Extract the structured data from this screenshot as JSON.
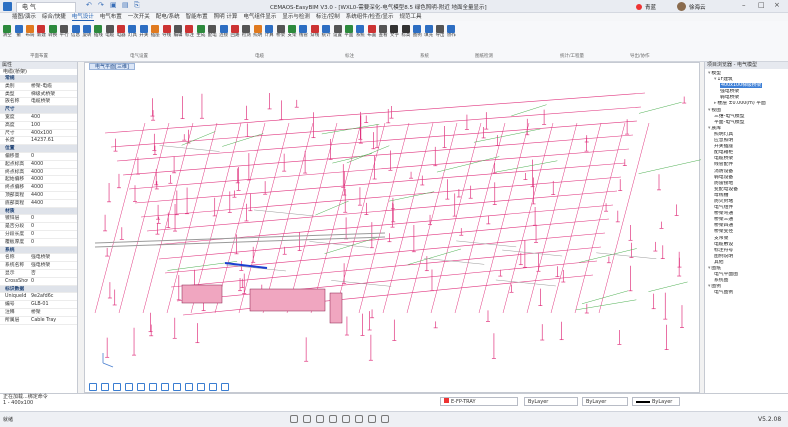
{
  "app": {
    "tab": "电 气",
    "title": "CEMAOS-EasyBIM V3.0 - [WXL0-需要深化-电气模型8.5 绿色照明-附近 地面全量显示]",
    "user_name": "徐海云",
    "badge": "青蓝"
  },
  "menu": [
    "插图/演示",
    "综合/快捷",
    "电气设计",
    "电气布置",
    "一次开关",
    "配电/系统",
    "智能布置",
    "照明 计算",
    "电气组件显示",
    "显示与检测",
    "标注/控制",
    "系统组件/检查/显示",
    "规范工具"
  ],
  "menu_active": 2,
  "ribbon": {
    "buttons": [
      {
        "label": "清空",
        "color": "#2d8a3d"
      },
      {
        "label": "撤",
        "color": "#2d6ec2"
      },
      {
        "label": "布局",
        "color": "#e07a1f"
      },
      {
        "label": "新建",
        "color": "#c33"
      },
      {
        "label": "转换",
        "color": "#2d8a3d"
      },
      {
        "label": "平行",
        "color": "#555"
      },
      {
        "label": "信息",
        "color": "#2d6ec2"
      },
      {
        "label": "旋转",
        "color": "#2d6ec2"
      },
      {
        "label": "插线",
        "color": "#2d8a3d"
      },
      {
        "label": "电缆",
        "color": "#555"
      },
      {
        "label": "电器",
        "color": "#c33"
      },
      {
        "label": "灯具",
        "color": "#2d6ec2"
      },
      {
        "label": "开关",
        "color": "#2d6ec2"
      },
      {
        "label": "插座",
        "color": "#e07a1f"
      },
      {
        "label": "导线",
        "color": "#c33"
      },
      {
        "label": "编辑",
        "color": "#555"
      },
      {
        "label": "标注",
        "color": "#c33"
      },
      {
        "label": "生成",
        "color": "#2d8a3d"
      },
      {
        "label": "配电",
        "color": "#555"
      },
      {
        "label": "连接",
        "color": "#2d6ec2"
      },
      {
        "label": "回路",
        "color": "#c33"
      },
      {
        "label": "检测",
        "color": "#555"
      },
      {
        "label": "照明",
        "color": "#e07a1f"
      },
      {
        "label": "计算",
        "color": "#2d6ec2"
      },
      {
        "label": "桥架",
        "color": "#555"
      },
      {
        "label": "支架",
        "color": "#2d8a3d"
      },
      {
        "label": "线管",
        "color": "#2d6ec2"
      },
      {
        "label": "穿线",
        "color": "#c33"
      },
      {
        "label": "统计",
        "color": "#2d6ec2"
      },
      {
        "label": "设置",
        "color": "#555"
      },
      {
        "label": "平面",
        "color": "#2d8a3d"
      },
      {
        "label": "系统",
        "color": "#2d6ec2"
      },
      {
        "label": "布置",
        "color": "#c33"
      },
      {
        "label": "查看",
        "color": "#555"
      },
      {
        "label": "文字",
        "color": "#333"
      },
      {
        "label": "标高",
        "color": "#333"
      },
      {
        "label": "图例",
        "color": "#2d6ec2"
      },
      {
        "label": "填充",
        "color": "#2d6ec2"
      },
      {
        "label": "导出",
        "color": "#555"
      },
      {
        "label": "协作",
        "color": "#2d6ec2"
      }
    ],
    "groups": [
      "平面布置",
      "电气设置",
      "电缆",
      "标注",
      "系统",
      "图纸检测",
      "统计/工程量",
      "导出/协作"
    ]
  },
  "left": {
    "head": "属性",
    "selection": "电缆(桥架)",
    "props": [
      {
        "k": "常规",
        "v": "",
        "sec": true
      },
      {
        "k": "类别",
        "v": "桥架-电缆"
      },
      {
        "k": "类型",
        "v": "梯级式桥架"
      },
      {
        "k": "族名称",
        "v": "电缆桥架"
      },
      {
        "k": "尺寸",
        "v": "",
        "sec": true
      },
      {
        "k": "宽度",
        "v": "400"
      },
      {
        "k": "高度",
        "v": "100"
      },
      {
        "k": "尺寸",
        "v": "400x100"
      },
      {
        "k": "长度",
        "v": "14237.61"
      },
      {
        "k": "位置",
        "v": "",
        "sec": true
      },
      {
        "k": "偏移量",
        "v": "0"
      },
      {
        "k": "起点标高",
        "v": "4000"
      },
      {
        "k": "终点标高",
        "v": "4000"
      },
      {
        "k": "起始偏移",
        "v": "4000"
      },
      {
        "k": "终点偏移",
        "v": "4000"
      },
      {
        "k": "顶部高程",
        "v": "4400"
      },
      {
        "k": "底部高程",
        "v": "4400"
      },
      {
        "k": "材质",
        "v": "",
        "sec": true
      },
      {
        "k": "镀锌层",
        "v": "0"
      },
      {
        "k": "是否分段",
        "v": "0"
      },
      {
        "k": "分段长度",
        "v": "0"
      },
      {
        "k": "覆板厚度",
        "v": "0"
      },
      {
        "k": "系统",
        "v": "",
        "sec": true
      },
      {
        "k": "名称",
        "v": "强电桥架"
      },
      {
        "k": "系统名称",
        "v": "强电桥架"
      },
      {
        "k": "显示",
        "v": "否"
      },
      {
        "k": "CrossShow",
        "v": "0"
      },
      {
        "k": "标识数据",
        "v": "",
        "sec": true
      },
      {
        "k": "UniqueId",
        "v": "9e2afd6c"
      },
      {
        "k": "编号",
        "v": "GLB-01"
      },
      {
        "k": "注释",
        "v": "桥架"
      },
      {
        "k": "所属层",
        "v": "Cable Tray"
      }
    ]
  },
  "viewport": {
    "tab": "电气平面[三维]"
  },
  "tree": {
    "head": "项目浏览器 - 电气模型",
    "items": [
      {
        "d": 0,
        "t": "模型",
        "tw": "▾"
      },
      {
        "d": 1,
        "t": "1F建筑",
        "tw": "▾"
      },
      {
        "d": 2,
        "t": "400x100梯级桥架",
        "sel": true
      },
      {
        "d": 2,
        "t": "强电桥架"
      },
      {
        "d": 2,
        "t": "弱电桥架"
      },
      {
        "d": 1,
        "t": "楼层 ±0.000(m) 平面",
        "tw": "▸"
      },
      {
        "d": 0,
        "t": "视图",
        "tw": "▾"
      },
      {
        "d": 1,
        "t": "三维-电气模型"
      },
      {
        "d": 1,
        "t": "平面-电气模型"
      },
      {
        "d": 0,
        "t": "族库",
        "tw": "▾"
      },
      {
        "d": 1,
        "t": "照明灯具"
      },
      {
        "d": 1,
        "t": "应急照明"
      },
      {
        "d": 1,
        "t": "开关插座"
      },
      {
        "d": 1,
        "t": "配电箱柜"
      },
      {
        "d": 1,
        "t": "电缆桥架"
      },
      {
        "d": 1,
        "t": "线管配件"
      },
      {
        "d": 1,
        "t": "消防设备"
      },
      {
        "d": 1,
        "t": "弱电设备"
      },
      {
        "d": 1,
        "t": "防雷接地"
      },
      {
        "d": 1,
        "t": "变配电设备"
      },
      {
        "d": 1,
        "t": "母线槽"
      },
      {
        "d": 1,
        "t": "防火封堵"
      },
      {
        "d": 1,
        "t": "电气组件"
      },
      {
        "d": 1,
        "t": "桥架弯通"
      },
      {
        "d": 1,
        "t": "桥架三通"
      },
      {
        "d": 1,
        "t": "桥架四通"
      },
      {
        "d": 1,
        "t": "桥架变径"
      },
      {
        "d": 1,
        "t": "支吊架"
      },
      {
        "d": 1,
        "t": "电缆敷设"
      },
      {
        "d": 1,
        "t": "标注符号"
      },
      {
        "d": 1,
        "t": "图例说明"
      },
      {
        "d": 1,
        "t": "其他"
      },
      {
        "d": 0,
        "t": "图纸",
        "tw": "▾"
      },
      {
        "d": 1,
        "t": "电气平面图"
      },
      {
        "d": 1,
        "t": "系统图"
      },
      {
        "d": 0,
        "t": "图例",
        "tw": "▾"
      },
      {
        "d": 1,
        "t": "电气图例"
      }
    ]
  },
  "cmd": {
    "line1": "正在加载...绑定命令",
    "line2": "1 - 400x100"
  },
  "layers": {
    "layer": "E-FP-TRAY",
    "linetype": "ByLayer",
    "color": "ByLayer",
    "lineweight": "ByLayer"
  },
  "status": {
    "left": "就绪",
    "version": "V5.2.08"
  },
  "colors": {
    "magenta": "#e0357f",
    "pink": "#f0a6c0",
    "dark": "#8a1a4a",
    "green": "#4caf50",
    "blue": "#1a3fd1",
    "gray": "#9a9a9a"
  }
}
